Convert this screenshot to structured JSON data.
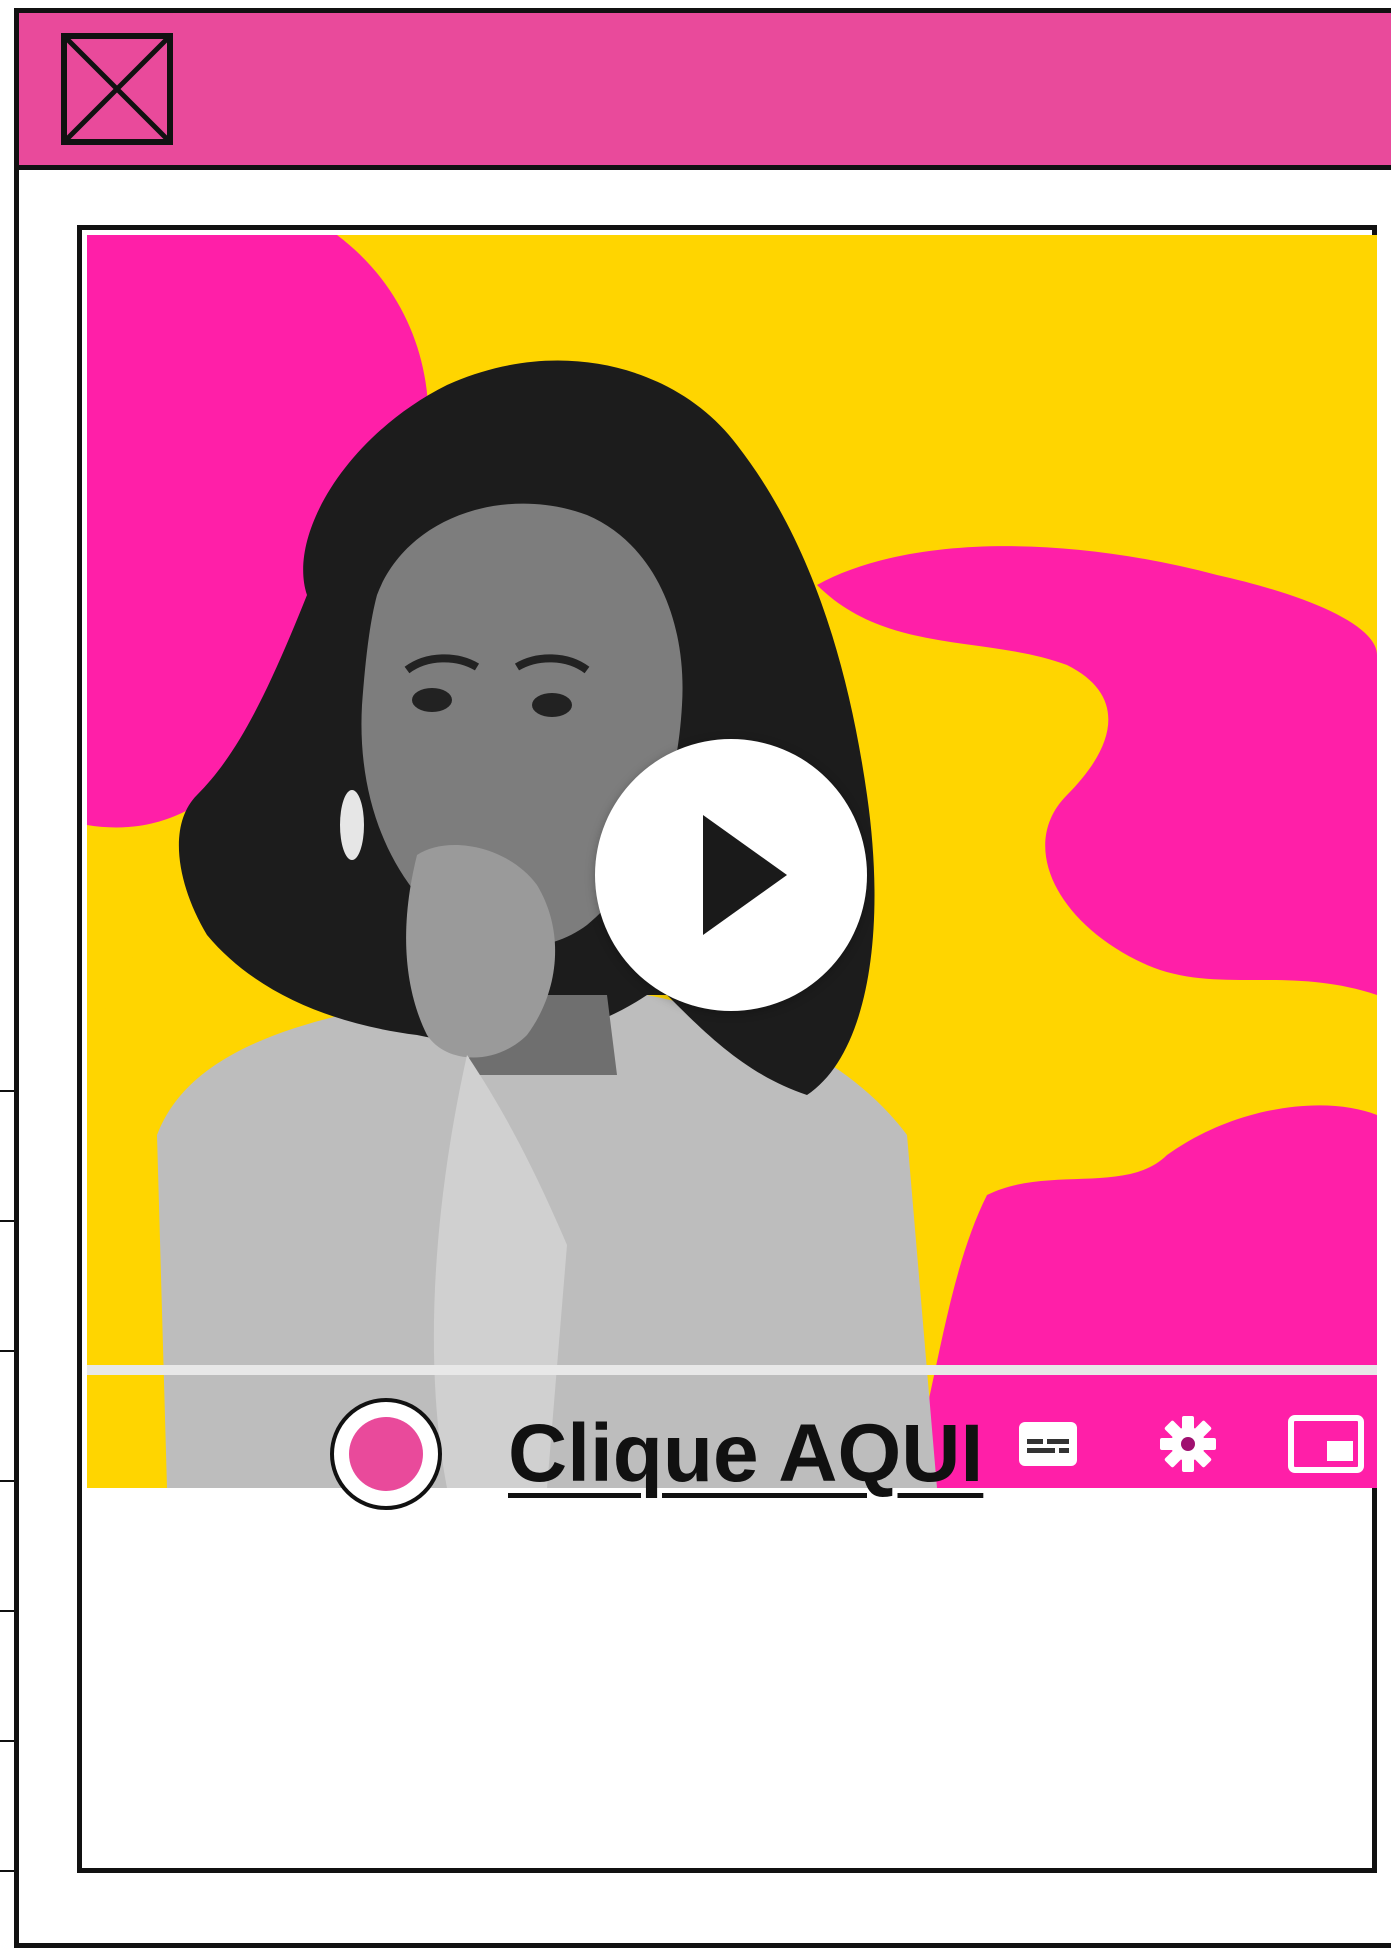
{
  "colors": {
    "brand_pink": "#e94a9b",
    "video_pink": "#ff1fa8",
    "video_yellow": "#ffd500",
    "ink": "#111111",
    "progress_track": "#e8e8e8"
  },
  "window": {
    "close_icon": "close-icon"
  },
  "video": {
    "play_icon": "play-icon",
    "controls": [
      {
        "icon": "subtitles-icon"
      },
      {
        "icon": "gear-icon"
      },
      {
        "icon": "miniplayer-icon"
      }
    ]
  },
  "cta": {
    "label": "Clique AQUI",
    "radio_icon": "radio-icon"
  }
}
